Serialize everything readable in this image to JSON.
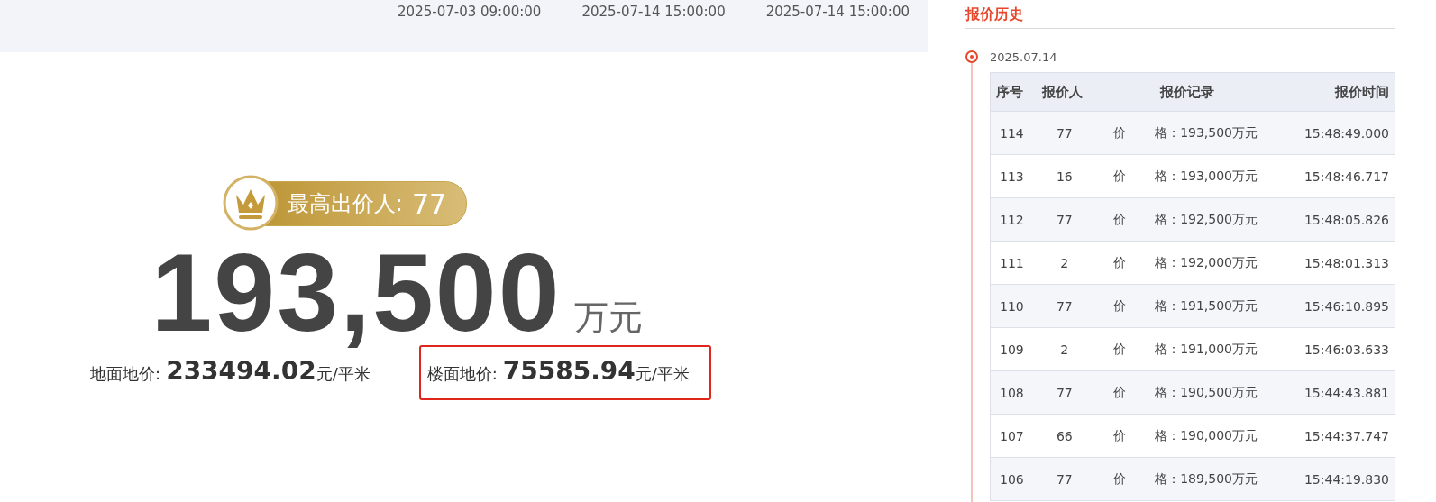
{
  "schedule": {
    "times": [
      "2025-07-03 09:00:00",
      "2025-07-14 15:00:00",
      "2025-07-14 15:00:00"
    ]
  },
  "result": {
    "badge_label": "最高出价人:",
    "badge_value": "77",
    "price": "193,500",
    "price_unit": "万元",
    "unit_prices": [
      {
        "label": "地面地价:",
        "value": "233494.02",
        "unit": "元/平米",
        "highlighted": false
      },
      {
        "label": "楼面地价:",
        "value": "75585.94",
        "unit": "元/平米",
        "highlighted": true
      }
    ]
  },
  "history": {
    "title": "报价历史",
    "date": "2025.07.14",
    "columns": [
      "序号",
      "报价人",
      "报价记录",
      "报价时间"
    ],
    "rows": [
      {
        "no": "114",
        "bidder": "77",
        "record": "价 格：193,500万元",
        "time": "15:48:49.000"
      },
      {
        "no": "113",
        "bidder": "16",
        "record": "价 格：193,000万元",
        "time": "15:48:46.717"
      },
      {
        "no": "112",
        "bidder": "77",
        "record": "价 格：192,500万元",
        "time": "15:48:05.826"
      },
      {
        "no": "111",
        "bidder": "2",
        "record": "价 格：192,000万元",
        "time": "15:48:01.313"
      },
      {
        "no": "110",
        "bidder": "77",
        "record": "价 格：191,500万元",
        "time": "15:46:10.895"
      },
      {
        "no": "109",
        "bidder": "2",
        "record": "价 格：191,000万元",
        "time": "15:46:03.633"
      },
      {
        "no": "108",
        "bidder": "77",
        "record": "价 格：190,500万元",
        "time": "15:44:43.881"
      },
      {
        "no": "107",
        "bidder": "66",
        "record": "价 格：190,000万元",
        "time": "15:44:37.747"
      },
      {
        "no": "106",
        "bidder": "77",
        "record": "价 格：189,500万元",
        "time": "15:44:19.830"
      }
    ]
  }
}
